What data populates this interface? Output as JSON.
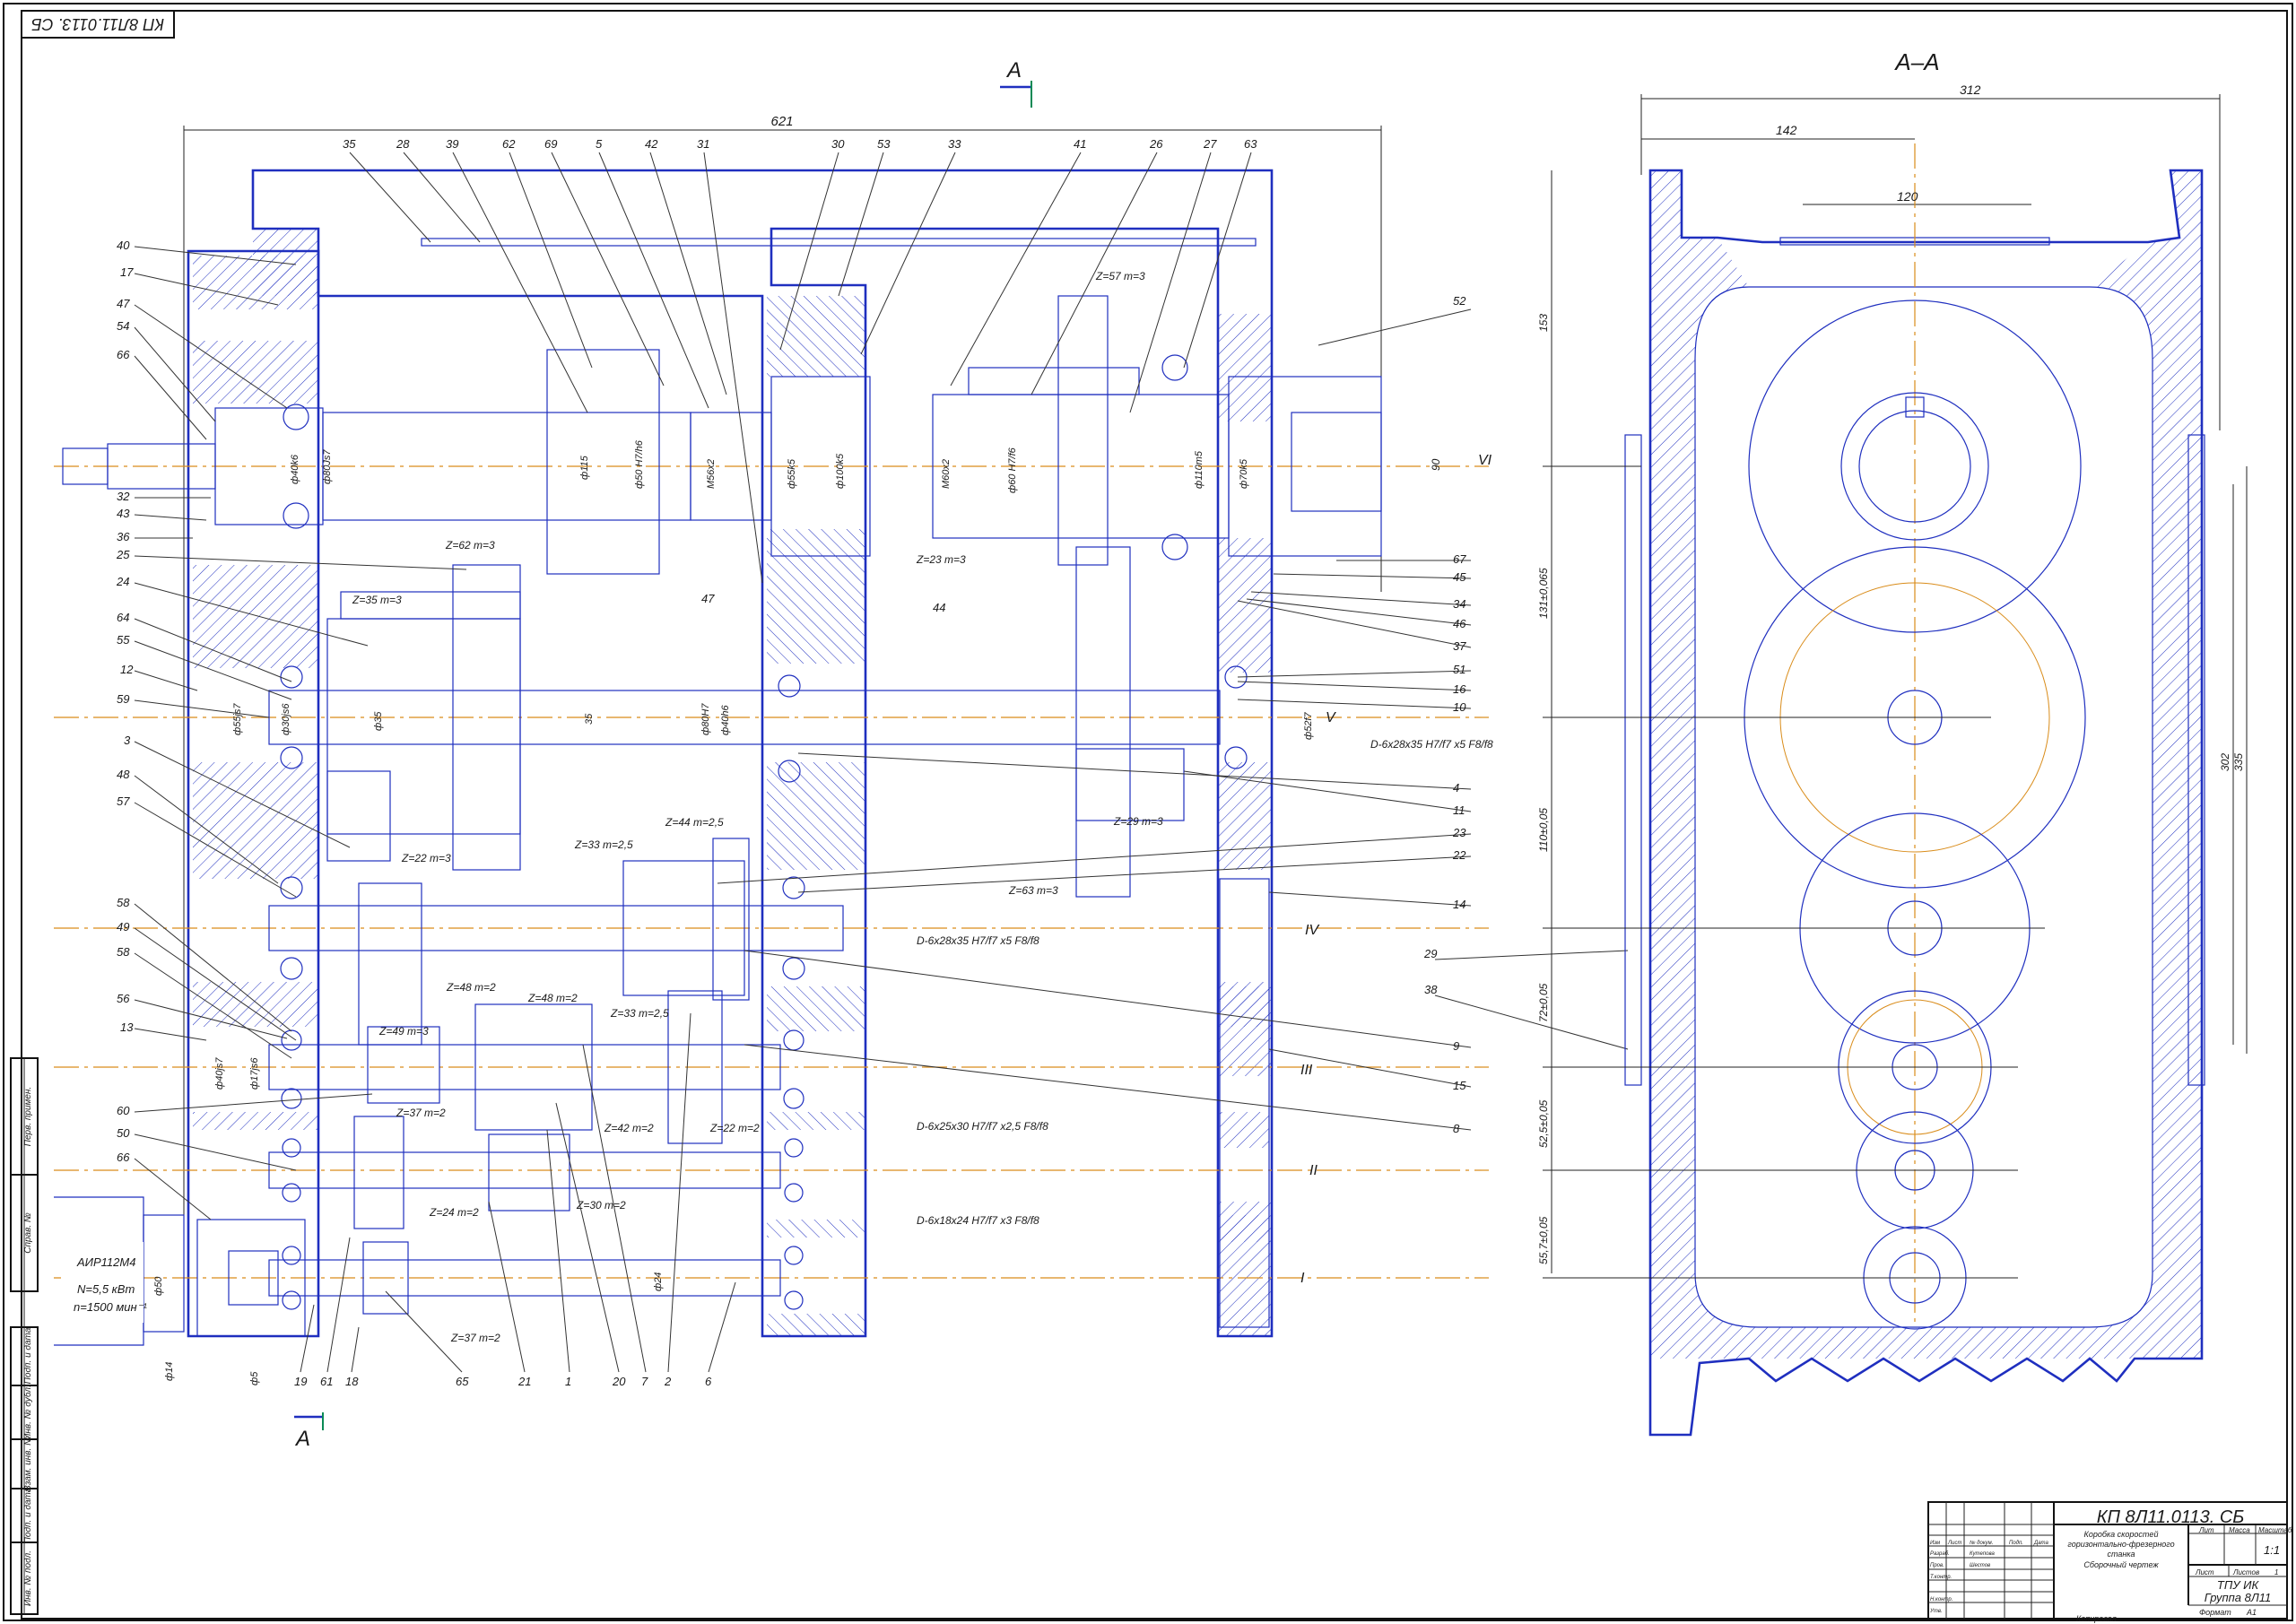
{
  "stamp_top": "КП 8Л11.0113. СБ",
  "section_title": "А–А",
  "section_marker": "А",
  "title_block": {
    "designation": "КП 8Л11.0113. СБ",
    "name_lines": [
      "Коробка скоростей",
      "горизонтально-фрезерного",
      "станка",
      "Сборочный чертеж"
    ],
    "col_lit": "Лит",
    "col_mass": "Масса",
    "col_scale": "Масштаб",
    "scale_value": "1:1",
    "sheet_label": "Лист",
    "sheets_label": "Листов",
    "sheets_value": "1",
    "org": "ТПУ ИК",
    "group": "Группа 8Л11",
    "copied": "Копировал",
    "format": "Формат",
    "format_value": "А1",
    "rows": [
      "Изм",
      "Лист",
      "№ докум.",
      "Подп.",
      "Дата"
    ],
    "roles": [
      "Разраб.",
      "Пров.",
      "Т.контр.",
      "Н.контр.",
      "Утв."
    ],
    "names": [
      "Кутепова",
      "Шестов"
    ]
  },
  "motor": {
    "model": "АИР112М4",
    "power": "N=5,5 кВт",
    "speed": "n=1500 мин⁻¹"
  },
  "left_side_labels": [
    "Перв. примен.",
    "Справ. №",
    "Подп. и дата",
    "Инв. № дубл.",
    "Взам. инв. №",
    "Подп. и дата",
    "Инв. № подл."
  ],
  "dims_main": {
    "overall": "621"
  },
  "dims_section": {
    "width": "312",
    "half": "142",
    "top": "120",
    "h1": "153",
    "h2": "131±0,065",
    "h3": "110±0,05",
    "h4": "72±0,05",
    "h5": "52,5±0,05",
    "h6": "55,7±0,05",
    "side1": "302",
    "side2": "335",
    "wall": "90"
  },
  "shaft_labels": [
    "VI",
    "V",
    "IV",
    "III",
    "II",
    "I"
  ],
  "gear_notes": [
    "Z=57 m=3",
    "Z=62 m=3",
    "Z=35 m=3",
    "Z=23 m=3",
    "Z=29 m=3",
    "Z=63 m=3",
    "Z=22 m=3",
    "Z=33 m=2,5",
    "Z=44 m=2,5",
    "Z=49 m=3",
    "Z=48 m=2",
    "Z=48 m=2",
    "Z=33 m=2,5",
    "Z=37 m=2",
    "Z=42 m=2",
    "Z=22 m=2",
    "Z=24 m=2",
    "Z=30 m=2",
    "Z=37 m=2"
  ],
  "spline_notes": [
    "D-6x28x35 H7/f7 x5 F8/f8",
    "D-6x28x35 H7/f7 x5 F8/f8",
    "D-6x25x30 H7/f7 x2,5 F8/f8",
    "D-6x18x24 H7/f7 x3 F8/f8"
  ],
  "diam_notes": [
    "ф40k6",
    "ф80Js7",
    "ф115",
    "ф50 H7/h6",
    "M56x2",
    "ф55k5",
    "ф100k5",
    "M60x2",
    "ф60 H7/f6",
    "ф110m5",
    "ф70k5",
    "ф55js7",
    "ф30js6",
    "ф35",
    "35",
    "ф80H7",
    "ф40h6",
    "ф52f7",
    "ф40js7",
    "ф17js6",
    "ф24",
    "ф50",
    "ф14",
    "ф5"
  ],
  "callouts_left": [
    "40",
    "17",
    "47",
    "54",
    "66",
    "32",
    "43",
    "36",
    "25",
    "24",
    "64",
    "55",
    "12",
    "59",
    "3",
    "48",
    "57",
    "58",
    "49",
    "58",
    "56",
    "13",
    "60",
    "50",
    "66"
  ],
  "callouts_top": [
    "35",
    "28",
    "39",
    "62",
    "69",
    "5",
    "42",
    "31",
    "30",
    "53",
    "33",
    "41",
    "26",
    "27",
    "63"
  ],
  "callouts_right": [
    "52",
    "67",
    "45",
    "34",
    "46",
    "37",
    "51",
    "16",
    "10",
    "4",
    "11",
    "23",
    "22",
    "14",
    "29",
    "38",
    "9",
    "15",
    "8"
  ],
  "callouts_bottom": [
    "19",
    "61",
    "18",
    "65",
    "21",
    "1",
    "20",
    "7",
    "2",
    "6"
  ],
  "callouts_mid": [
    "47",
    "44"
  ]
}
